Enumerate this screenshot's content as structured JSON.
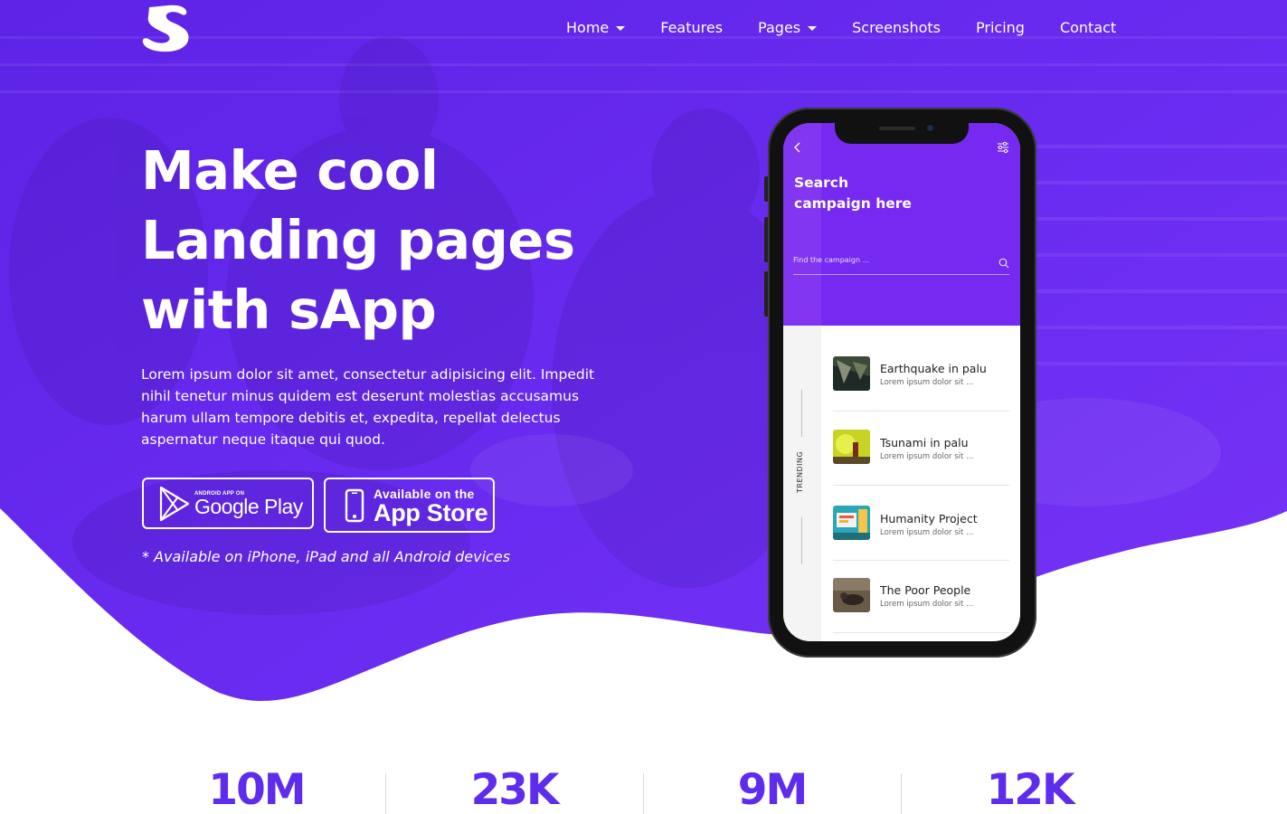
{
  "brand": {
    "logo_letter": "S",
    "colors": {
      "primary": "#6a2bf3",
      "deep": "#5a22e8",
      "stat": "#5e2ced",
      "white": "#ffffff"
    }
  },
  "nav": {
    "items": [
      {
        "label": "Home",
        "has_dropdown": true
      },
      {
        "label": "Features",
        "has_dropdown": false
      },
      {
        "label": "Pages",
        "has_dropdown": true
      },
      {
        "label": "Screenshots",
        "has_dropdown": false
      },
      {
        "label": "Pricing",
        "has_dropdown": false
      },
      {
        "label": "Contact",
        "has_dropdown": false
      }
    ]
  },
  "hero": {
    "headline": [
      "Make cool",
      "Landing pages",
      "with sApp"
    ],
    "intro": "Lorem ipsum dolor sit amet, consectetur adipisicing elit. Impedit nihil tenetur minus quidem est deserunt molestias accusamus harum ullam tempore debitis et, expedita, repellat delectus aspernatur neque itaque qui quod.",
    "google_play": {
      "small": "ANDROID APP ON",
      "big": "Google Play",
      "icon": "google-play-icon"
    },
    "app_store": {
      "small": "Available on the",
      "big": "App Store",
      "icon": "iphone-icon"
    },
    "availability_note": "* Available on iPhone, iPad and all Android devices"
  },
  "phone": {
    "title_lines": [
      "Search",
      "campaign here"
    ],
    "search_placeholder": "Find the campaign ...",
    "trending_label": "TRENDING",
    "items": [
      {
        "title": "Earthquake in palu",
        "subtitle": "Lorem ipsum dolor sit ..."
      },
      {
        "title": "Tsunami in palu",
        "subtitle": "Lorem ipsum dolor sit ..."
      },
      {
        "title": "Humanity Project",
        "subtitle": "Lorem ipsum dolor sit ..."
      },
      {
        "title": "The Poor People",
        "subtitle": "Lorem ipsum dolor sit ..."
      }
    ]
  },
  "stats": {
    "values": [
      "10M",
      "23K",
      "9M",
      "12K"
    ]
  }
}
